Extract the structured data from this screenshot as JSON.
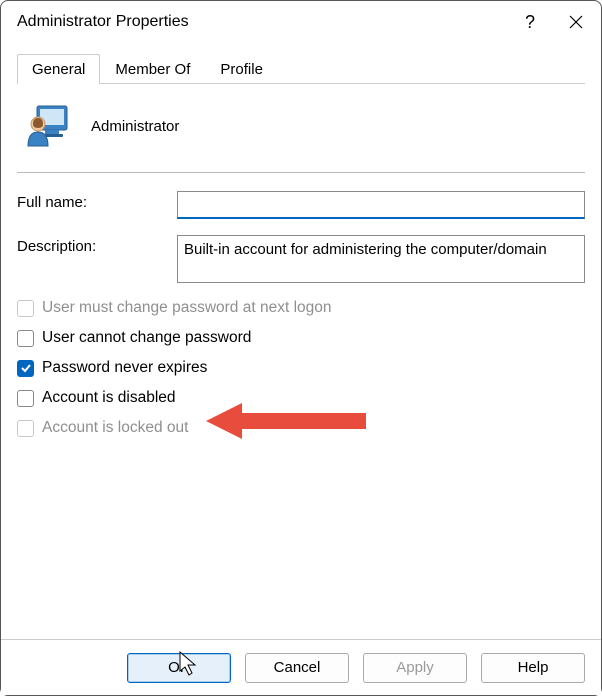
{
  "window": {
    "title": "Administrator Properties"
  },
  "tabs": {
    "items": [
      {
        "label": "General",
        "active": true
      },
      {
        "label": "Member Of",
        "active": false
      },
      {
        "label": "Profile",
        "active": false
      }
    ]
  },
  "user": {
    "display_name": "Administrator"
  },
  "fields": {
    "full_name_label": "Full name:",
    "full_name_value": "",
    "description_label": "Description:",
    "description_value": "Built-in account for administering the computer/domain"
  },
  "checkboxes": {
    "must_change": {
      "label": "User must change password at next logon",
      "checked": false,
      "enabled": false
    },
    "cannot_change": {
      "label": "User cannot change password",
      "checked": false,
      "enabled": true
    },
    "never_expires": {
      "label": "Password never expires",
      "checked": true,
      "enabled": true
    },
    "disabled": {
      "label": "Account is disabled",
      "checked": false,
      "enabled": true
    },
    "locked_out": {
      "label": "Account is locked out",
      "checked": false,
      "enabled": false
    }
  },
  "buttons": {
    "ok": "OK",
    "cancel": "Cancel",
    "apply": "Apply",
    "help": "Help"
  },
  "annotation": {
    "arrow_color": "#e74c3c"
  }
}
